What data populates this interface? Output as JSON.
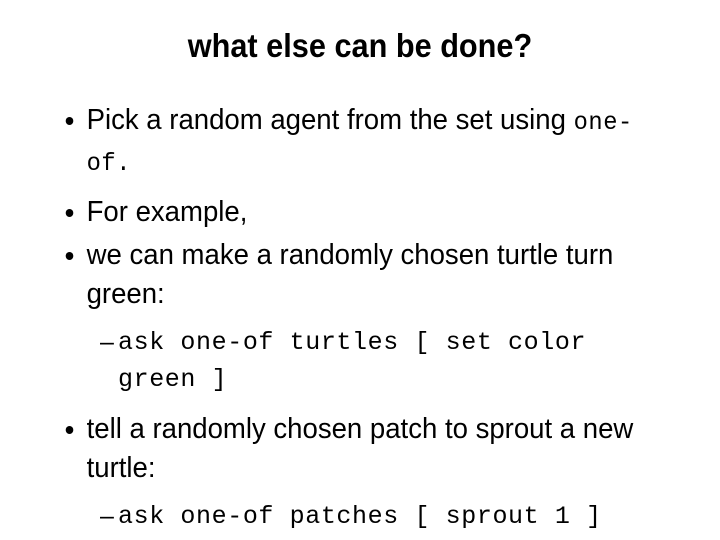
{
  "slide": {
    "title": "what else can be done?",
    "background_color": "#ffffff",
    "text_color": "#000000",
    "bullet_glyph": "•",
    "sub_bullet_glyph": "–",
    "content": [
      {
        "level": 1,
        "name": "bullet-pick-random-agent",
        "text_sans": "Pick a random agent from the set using",
        "text_mono": "one-of."
      },
      {
        "level": 1,
        "name": "bullet-for-example",
        "text_sans": "For example,",
        "text_mono": ""
      },
      {
        "level": 1,
        "name": "bullet-make-turtle-green",
        "text_sans": "we can make a randomly chosen turtle turn green:",
        "text_mono": ""
      },
      {
        "level": 2,
        "name": "code-ask-one-of-turtles",
        "text_mono": "ask one-of turtles [ set color green ]"
      },
      {
        "level": 1,
        "name": "bullet-sprout-new-turtle",
        "text_sans": "tell a randomly chosen patch to sprout a new turtle:",
        "text_mono": ""
      },
      {
        "level": 2,
        "name": "code-ask-one-of-patches",
        "text_mono": "ask one-of patches [ sprout 1 ]"
      }
    ]
  }
}
